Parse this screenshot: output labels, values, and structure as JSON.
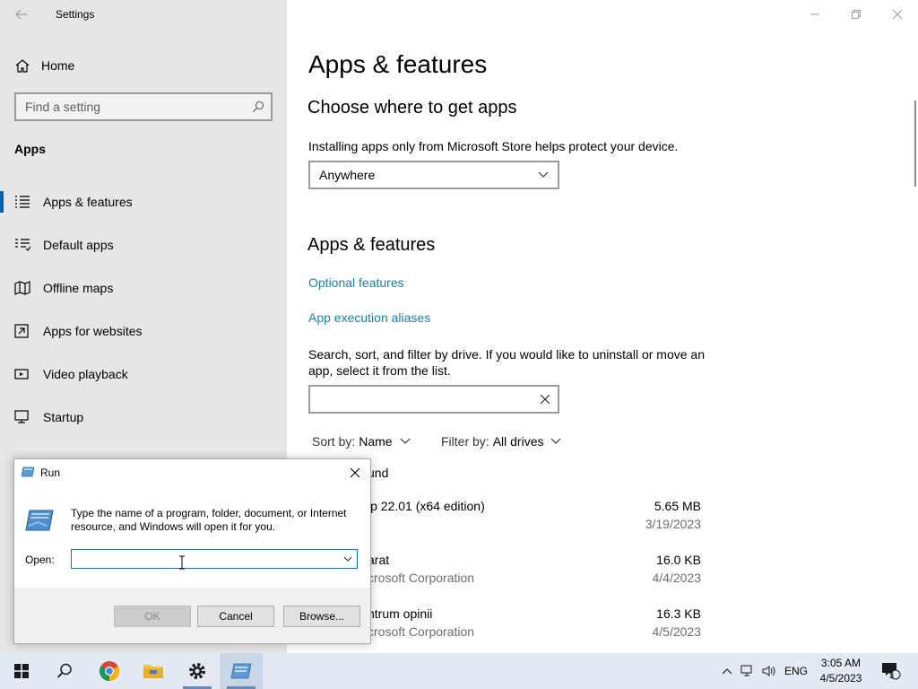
{
  "window": {
    "title": "Settings"
  },
  "sidebar": {
    "home_label": "Home",
    "search_placeholder": "Find a setting",
    "section_title": "Apps",
    "items": [
      {
        "label": "Apps & features",
        "icon": "apps-features-icon",
        "selected": true
      },
      {
        "label": "Default apps",
        "icon": "default-apps-icon"
      },
      {
        "label": "Offline maps",
        "icon": "offline-maps-icon"
      },
      {
        "label": "Apps for websites",
        "icon": "apps-for-websites-icon"
      },
      {
        "label": "Video playback",
        "icon": "video-playback-icon"
      },
      {
        "label": "Startup",
        "icon": "startup-icon"
      }
    ]
  },
  "main": {
    "page_title": "Apps & features",
    "choose_heading": "Choose where to get apps",
    "choose_desc": "Installing apps only from Microsoft Store helps protect your device.",
    "source_dropdown_value": "Anywhere",
    "apps_heading": "Apps & features",
    "optional_features_link": "Optional features",
    "app_aliases_link": "App execution aliases",
    "search_desc_line1": "Search, sort, and filter by drive. If you would like to uninstall or move an",
    "search_desc_line2": "app, select it from the list.",
    "search_value": "",
    "sort_label": "Sort by:",
    "sort_value": "Name",
    "filter_label": "Filter by:",
    "filter_value": "All drives",
    "found_text": "und",
    "apps": [
      {
        "name": "ip 22.01 (x64 edition)",
        "publisher": "",
        "size": "5.65 MB",
        "date": "3/19/2023"
      },
      {
        "name": "arat",
        "publisher": "crosoft Corporation",
        "size": "16.0 KB",
        "date": "4/4/2023"
      },
      {
        "name": "ntrum opinii",
        "publisher": "crosoft Corporation",
        "size": "16.3 KB",
        "date": "4/5/2023"
      }
    ]
  },
  "run_dialog": {
    "title": "Run",
    "description": "Type the name of a program, folder, document, or Internet resource, and Windows will open it for you.",
    "open_label": "Open:",
    "open_value": "",
    "ok_label": "OK",
    "cancel_label": "Cancel",
    "browse_label": "Browse..."
  },
  "taskbar": {
    "language": "ENG",
    "time": "3:05 AM",
    "date": "4/5/2023",
    "notification_count": "3"
  },
  "colors": {
    "accent": "#0063b1",
    "link": "#1a7fa8",
    "sidebar_bg": "#e6e6e6",
    "taskbar_bg": "#e3eaf3"
  }
}
